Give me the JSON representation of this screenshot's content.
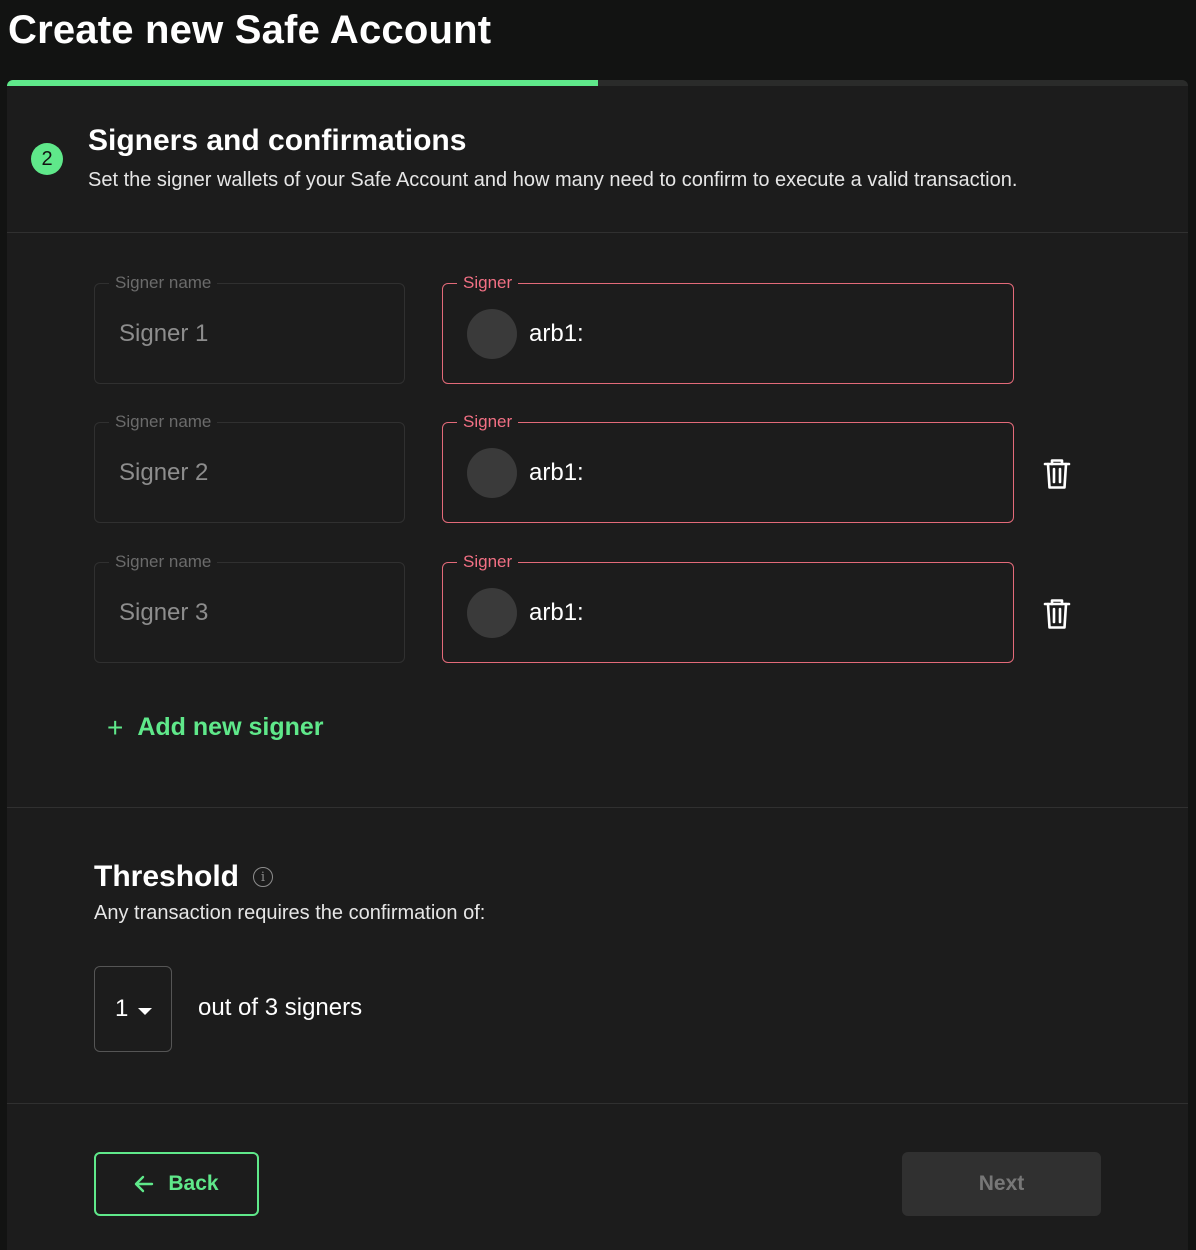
{
  "page": {
    "title": "Create new Safe Account"
  },
  "progress": {
    "fraction": 0.5
  },
  "step": {
    "number": "2",
    "title": "Signers and confirmations",
    "subtitle": "Set the signer wallets of your Safe Account and how many need to confirm to execute a valid transaction."
  },
  "signers": [
    {
      "name_label": "Signer name",
      "name_value": "Signer 1",
      "address_label": "Signer",
      "address_value": "arb1:",
      "deletable": false
    },
    {
      "name_label": "Signer name",
      "name_value": "Signer 2",
      "address_label": "Signer",
      "address_value": "arb1:",
      "deletable": true
    },
    {
      "name_label": "Signer name",
      "name_value": "Signer 3",
      "address_label": "Signer",
      "address_value": "arb1:",
      "deletable": true
    }
  ],
  "add_signer": {
    "icon": "plus-icon",
    "label": "Add new signer"
  },
  "threshold": {
    "title": "Threshold",
    "info_icon": "info-icon",
    "description": "Any transaction requires the confirmation of:",
    "selected": "1",
    "out_of_text": "out of 3 signers"
  },
  "footer": {
    "back_label": "Back",
    "next_label": "Next"
  },
  "colors": {
    "accent": "#5fe88a",
    "error": "#f27084",
    "background": "#121312",
    "card": "#1c1c1c"
  }
}
